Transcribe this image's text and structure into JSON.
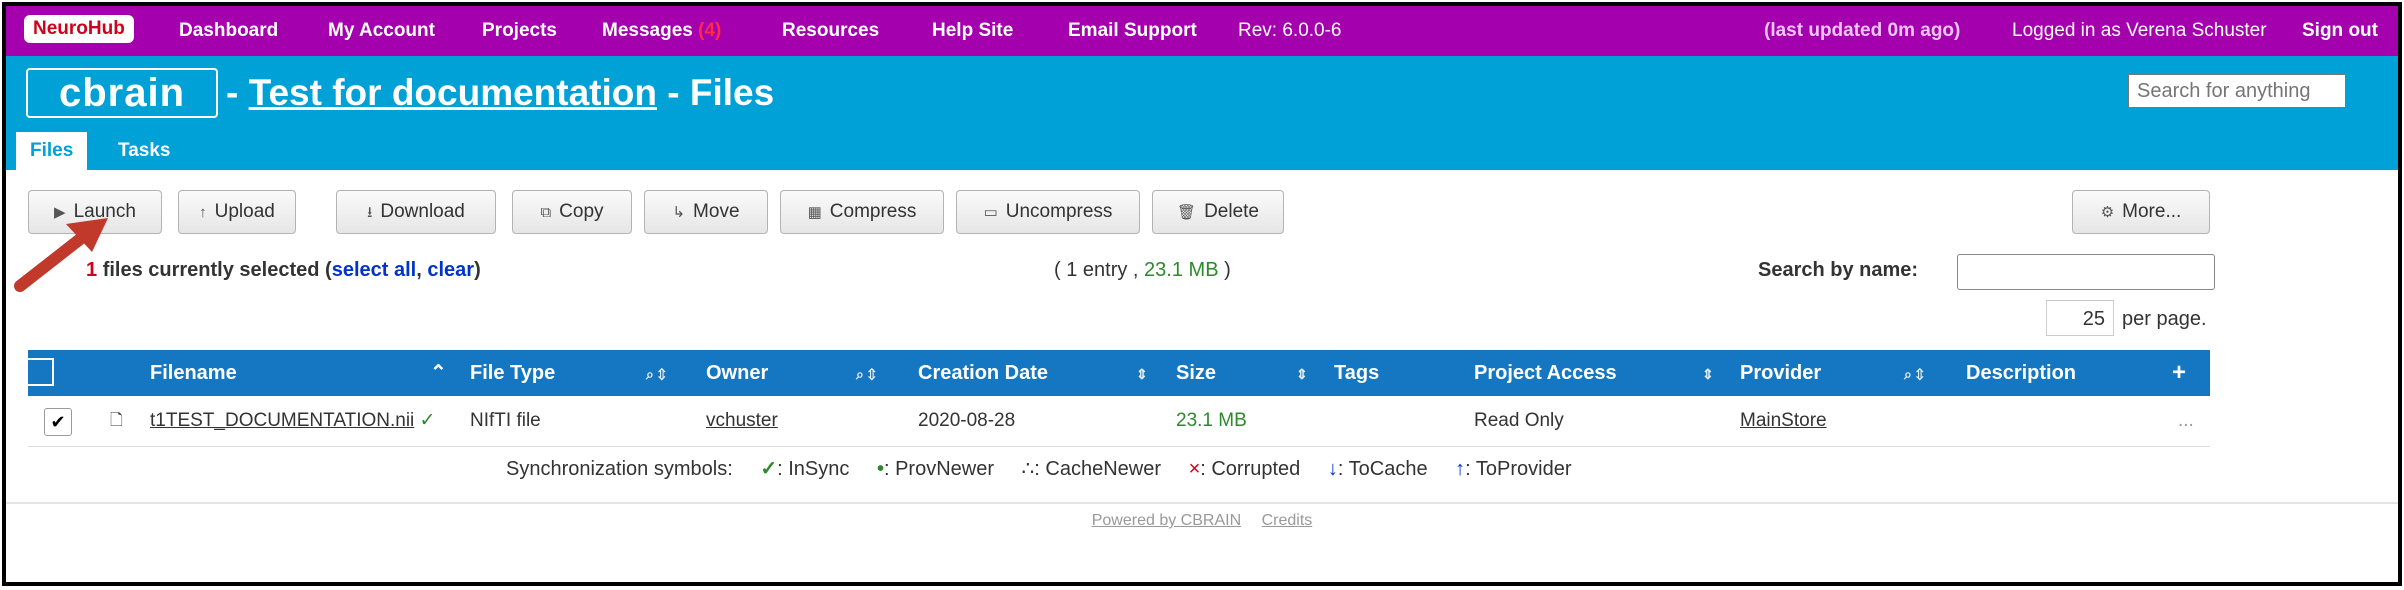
{
  "topbar": {
    "brand": "NeuroHub",
    "nav": [
      "Dashboard",
      "My Account",
      "Projects",
      "Messages",
      "Resources",
      "Help Site",
      "Email Support"
    ],
    "messages_count": "(4)",
    "revision": "Rev: 6.0.0-6",
    "last_updated": "(last updated 0m ago)",
    "logged_in": "Logged in as Verena Schuster",
    "signout": "Sign out"
  },
  "header": {
    "logo": "cbrain",
    "dash1": "-",
    "project": "Test for documentation",
    "dash2": "-",
    "page": "Files",
    "search_placeholder": "Search for anything",
    "tabs": [
      "Files",
      "Tasks"
    ]
  },
  "toolbar": {
    "launch": "Launch",
    "upload": "Upload",
    "download": "Download",
    "copy": "Copy",
    "move": "Move",
    "compress": "Compress",
    "uncompress": "Uncompress",
    "delete": "Delete",
    "more": "More..."
  },
  "selection": {
    "count": "1",
    "text": "files currently selected",
    "open": "(",
    "select_all": "select all",
    "comma": ",",
    "clear": "clear",
    "close": ")"
  },
  "summary": {
    "prefix": "( 1 entry ,",
    "size": "23.1 MB",
    "suffix": ")"
  },
  "search_by_name": {
    "label": "Search by name:"
  },
  "pagination": {
    "per_page_value": "25",
    "per_page_label": "per page."
  },
  "table": {
    "columns": [
      "Filename",
      "File Type",
      "Owner",
      "Creation Date",
      "Size",
      "Tags",
      "Project Access",
      "Provider",
      "Description"
    ],
    "add_column": "+",
    "rows": [
      {
        "checked": "✔",
        "filename": "t1TEST_DOCUMENTATION.nii",
        "sync": "✓",
        "file_type": "NIfTI file",
        "owner": "vchuster",
        "creation_date": "2020-08-28",
        "size": "23.1 MB",
        "tags": "",
        "project_access": "Read Only",
        "provider": "MainStore",
        "description": "..."
      }
    ]
  },
  "sync_legend": {
    "label": "Synchronization symbols:",
    "items": [
      {
        "symbol": "✓",
        "text": ": InSync",
        "color": "#2c8a2c"
      },
      {
        "symbol": "•",
        "text": ": ProvNewer",
        "color": "#2c8a2c"
      },
      {
        "symbol": "∴",
        "text": ": CacheNewer",
        "color": "#333333"
      },
      {
        "symbol": "×",
        "text": ": Corrupted",
        "color": "#d0021b"
      },
      {
        "symbol": "↓",
        "text": ": ToCache",
        "color": "#0033cc"
      },
      {
        "symbol": "↑",
        "text": ": ToProvider",
        "color": "#0033cc"
      }
    ]
  },
  "footer": {
    "powered": "Powered by CBRAIN",
    "credits": "Credits"
  },
  "colors": {
    "topbar": "#a400ae",
    "header": "#00a1d6",
    "table_header": "#1577c2",
    "annotation_arrow": "#c0392b"
  }
}
